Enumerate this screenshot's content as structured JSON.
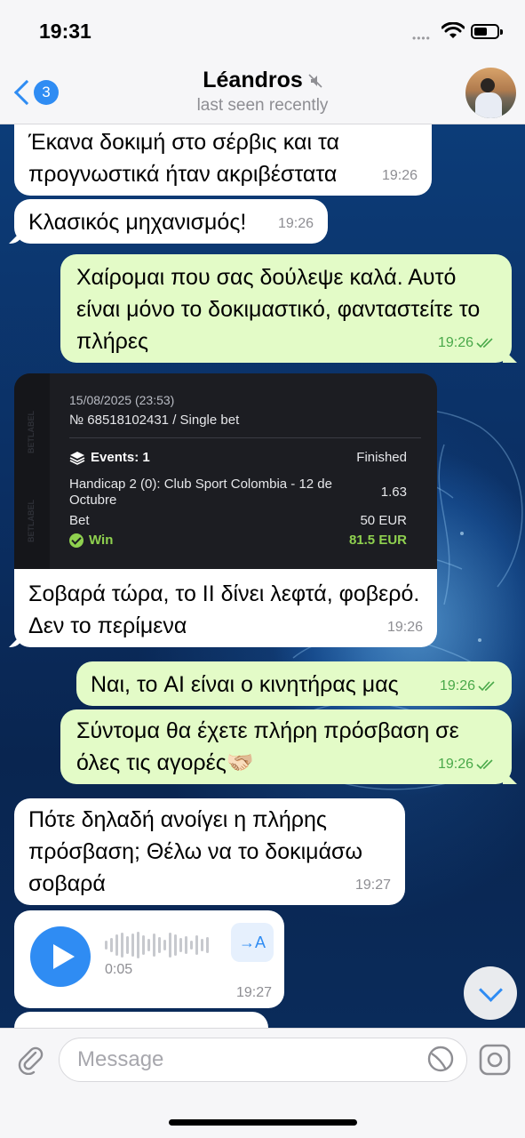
{
  "status_bar": {
    "time": "19:31",
    "signal_dots": "••••"
  },
  "header": {
    "back_badge": "3",
    "title": "Léandros",
    "subtitle": "last seen recently"
  },
  "messages": [
    {
      "direction": "in",
      "text": "Έκανα δοκιμή στο σέρβις και τα προγνωστικά ήταν ακριβέστατα",
      "time": "19:26"
    },
    {
      "direction": "in",
      "text": "Κλασικός μηχανισμός!",
      "time": "19:26"
    },
    {
      "direction": "out",
      "text": "Χαίρομαι που σας δούλεψε καλά. Αυτό είναι μόνο το δοκιμαστικό, φανταστείτε το πλήρες",
      "time": "19:26"
    },
    {
      "direction": "in",
      "text": "Σοβαρά τώρα, το ΙΙ δίνει λεφτά, φοβερό. Δεν το περίμενα",
      "time": "19:26"
    },
    {
      "direction": "out",
      "text": "Ναι, το AI είναι ο κινητήρας μας",
      "time": "19:26"
    },
    {
      "direction": "out",
      "text": "Σύντομα θα έχετε πλήρη πρόσβαση σε όλες τις αγορές🫱🏻‍🫲🏼",
      "time": "19:26"
    },
    {
      "direction": "in",
      "text": "Πότε δηλαδή ανοίγει η πλήρης πρόσβαση; Θέλω να το δοκιμάσω σοβαρά",
      "time": "19:27"
    }
  ],
  "bet_slip": {
    "date": "15/08/2025 (23:53)",
    "number": "№ 68518102431 / Single bet",
    "events_label": "Events: 1",
    "status": "Finished",
    "match": "Handicap 2 (0): Club Sport Colombia - 12 de Octubre",
    "odds": "1.63",
    "bet_label": "Bet",
    "bet_amount": "50 EUR",
    "win_label": "Win",
    "win_amount": "81.5 EUR",
    "watermark": "BETLABEL"
  },
  "voice_message": {
    "duration": "0:05",
    "transcribe_label": "→A",
    "time": "19:27"
  },
  "input": {
    "placeholder": "Message"
  },
  "colors": {
    "accent": "#2f8cf3",
    "outgoing_bubble": "#e3fbc7",
    "incoming_bubble": "#ffffff",
    "win_green": "#8fd14f"
  }
}
